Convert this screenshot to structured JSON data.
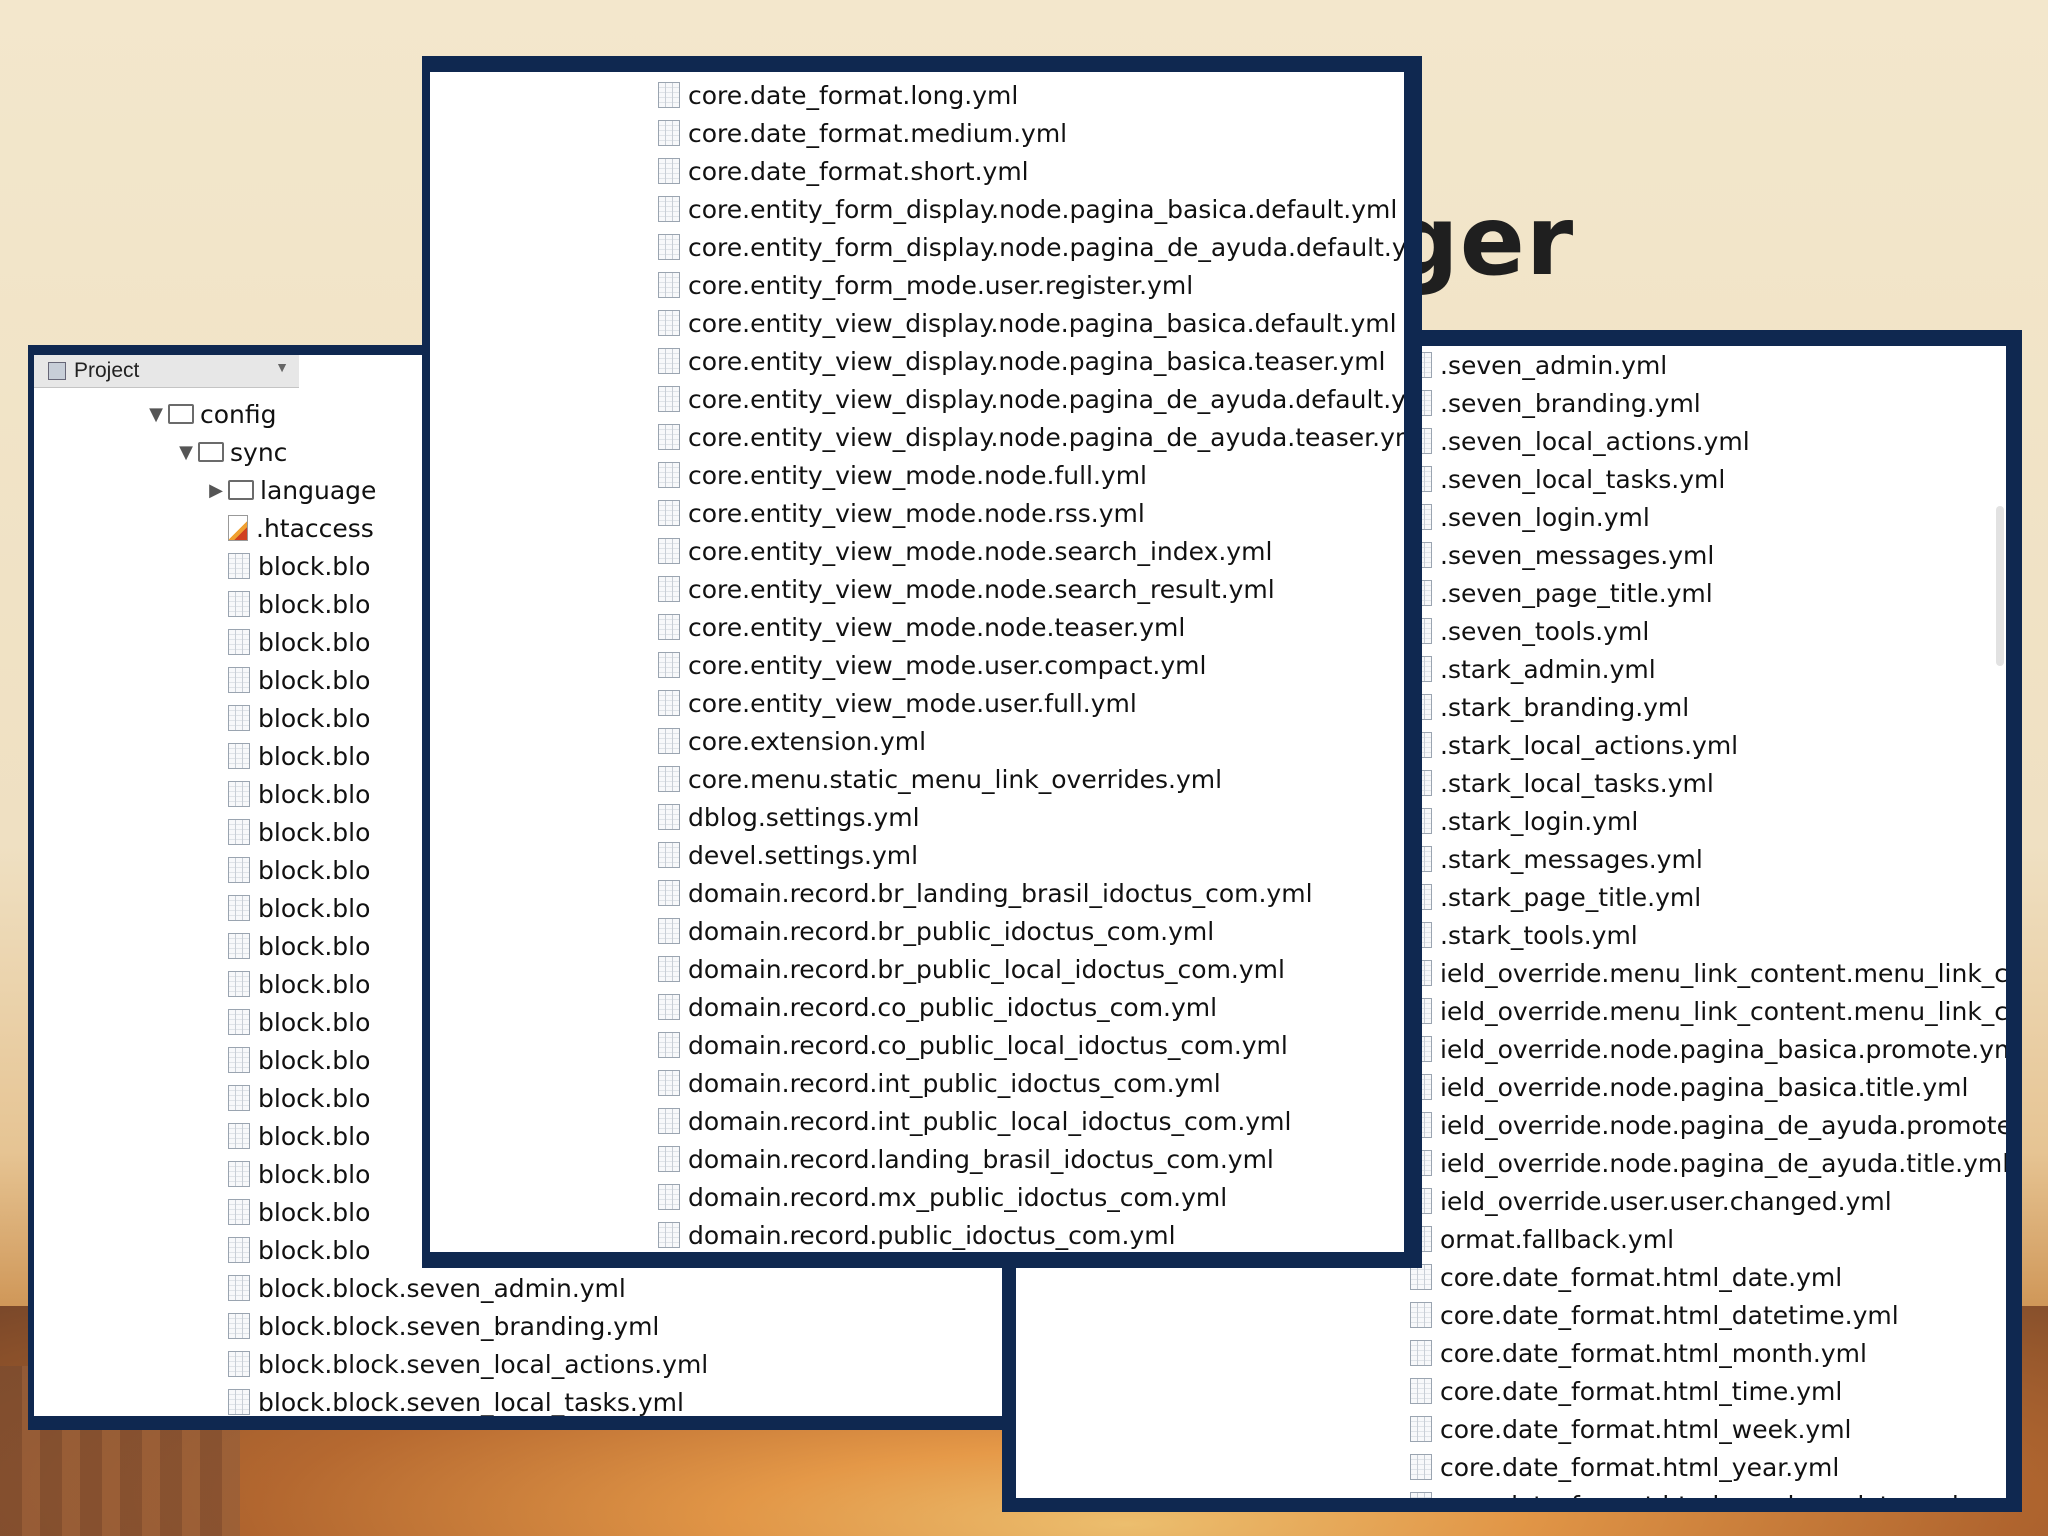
{
  "slide": {
    "title_fragment": "ger"
  },
  "left_panel": {
    "header": "Project",
    "tree": [
      {
        "label": "config",
        "kind": "folder",
        "arrow": "▼",
        "indent": 1
      },
      {
        "label": "sync",
        "kind": "folder",
        "arrow": "▼",
        "indent": 2
      },
      {
        "label": "language",
        "kind": "folder",
        "arrow": "▶",
        "indent": 3
      },
      {
        "label": ".htaccess",
        "kind": "htaccess",
        "arrow": "",
        "indent": 3
      },
      {
        "label": "block.blo",
        "kind": "file",
        "arrow": "",
        "indent": 3
      },
      {
        "label": "block.blo",
        "kind": "file",
        "arrow": "",
        "indent": 3
      },
      {
        "label": "block.blo",
        "kind": "file",
        "arrow": "",
        "indent": 3
      },
      {
        "label": "block.blo",
        "kind": "file",
        "arrow": "",
        "indent": 3
      },
      {
        "label": "block.blo",
        "kind": "file",
        "arrow": "",
        "indent": 3
      },
      {
        "label": "block.blo",
        "kind": "file",
        "arrow": "",
        "indent": 3
      },
      {
        "label": "block.blo",
        "kind": "file",
        "arrow": "",
        "indent": 3
      },
      {
        "label": "block.blo",
        "kind": "file",
        "arrow": "",
        "indent": 3
      },
      {
        "label": "block.blo",
        "kind": "file",
        "arrow": "",
        "indent": 3
      },
      {
        "label": "block.blo",
        "kind": "file",
        "arrow": "",
        "indent": 3
      },
      {
        "label": "block.blo",
        "kind": "file",
        "arrow": "",
        "indent": 3
      },
      {
        "label": "block.blo",
        "kind": "file",
        "arrow": "",
        "indent": 3
      },
      {
        "label": "block.blo",
        "kind": "file",
        "arrow": "",
        "indent": 3
      },
      {
        "label": "block.blo",
        "kind": "file",
        "arrow": "",
        "indent": 3
      },
      {
        "label": "block.blo",
        "kind": "file",
        "arrow": "",
        "indent": 3
      },
      {
        "label": "block.blo",
        "kind": "file",
        "arrow": "",
        "indent": 3
      },
      {
        "label": "block.blo",
        "kind": "file",
        "arrow": "",
        "indent": 3
      },
      {
        "label": "block.blo",
        "kind": "file",
        "arrow": "",
        "indent": 3
      },
      {
        "label": "block.blo",
        "kind": "file",
        "arrow": "",
        "indent": 3
      },
      {
        "label": "block.block.seven_admin.yml",
        "kind": "file",
        "arrow": "",
        "indent": 3
      },
      {
        "label": "block.block.seven_branding.yml",
        "kind": "file",
        "arrow": "",
        "indent": 3
      },
      {
        "label": "block.block.seven_local_actions.yml",
        "kind": "file",
        "arrow": "",
        "indent": 3
      },
      {
        "label": "block.block.seven_local_tasks.yml",
        "kind": "file",
        "arrow": "",
        "indent": 3
      }
    ]
  },
  "center_panel": {
    "files": [
      "core.date_format.long.yml",
      "core.date_format.medium.yml",
      "core.date_format.short.yml",
      "core.entity_form_display.node.pagina_basica.default.yml",
      "core.entity_form_display.node.pagina_de_ayuda.default.yml",
      "core.entity_form_mode.user.register.yml",
      "core.entity_view_display.node.pagina_basica.default.yml",
      "core.entity_view_display.node.pagina_basica.teaser.yml",
      "core.entity_view_display.node.pagina_de_ayuda.default.yml",
      "core.entity_view_display.node.pagina_de_ayuda.teaser.yml",
      "core.entity_view_mode.node.full.yml",
      "core.entity_view_mode.node.rss.yml",
      "core.entity_view_mode.node.search_index.yml",
      "core.entity_view_mode.node.search_result.yml",
      "core.entity_view_mode.node.teaser.yml",
      "core.entity_view_mode.user.compact.yml",
      "core.entity_view_mode.user.full.yml",
      "core.extension.yml",
      "core.menu.static_menu_link_overrides.yml",
      "dblog.settings.yml",
      "devel.settings.yml",
      "domain.record.br_landing_brasil_idoctus_com.yml",
      "domain.record.br_public_idoctus_com.yml",
      "domain.record.br_public_local_idoctus_com.yml",
      "domain.record.co_public_idoctus_com.yml",
      "domain.record.co_public_local_idoctus_com.yml",
      "domain.record.int_public_idoctus_com.yml",
      "domain.record.int_public_local_idoctus_com.yml",
      "domain.record.landing_brasil_idoctus_com.yml",
      "domain.record.mx_public_idoctus_com.yml",
      "domain.record.public_idoctus_com.yml"
    ]
  },
  "right_panel": {
    "files": [
      ".seven_admin.yml",
      ".seven_branding.yml",
      ".seven_local_actions.yml",
      ".seven_local_tasks.yml",
      ".seven_login.yml",
      ".seven_messages.yml",
      ".seven_page_title.yml",
      ".seven_tools.yml",
      ".stark_admin.yml",
      ".stark_branding.yml",
      ".stark_local_actions.yml",
      ".stark_local_tasks.yml",
      ".stark_login.yml",
      ".stark_messages.yml",
      ".stark_page_title.yml",
      ".stark_tools.yml",
      "ield_override.menu_link_content.menu_link_c",
      "ield_override.menu_link_content.menu_link_c",
      "ield_override.node.pagina_basica.promote.yml",
      "ield_override.node.pagina_basica.title.yml",
      "ield_override.node.pagina_de_ayuda.promote.",
      "ield_override.node.pagina_de_ayuda.title.yml",
      "ield_override.user.user.changed.yml",
      "ormat.fallback.yml",
      "core.date_format.html_date.yml",
      "core.date_format.html_datetime.yml",
      "core.date_format.html_month.yml",
      "core.date_format.html_time.yml",
      "core.date_format.html_week.yml",
      "core.date_format.html_year.yml",
      "core.date_format.html_yearless_date.yml"
    ]
  }
}
